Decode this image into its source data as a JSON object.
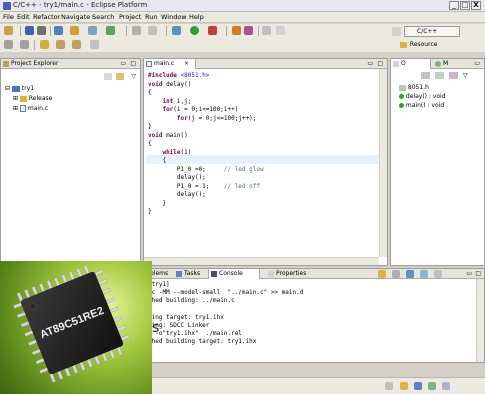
{
  "window": {
    "title": "C/C++ - try1/main.c - Eclipse Platform",
    "min": "_",
    "max": "□",
    "close": "X"
  },
  "menu": [
    "File",
    "Edit",
    "Refactor",
    "Navigate",
    "Search",
    "Project",
    "Run",
    "Window",
    "Help"
  ],
  "perspective": {
    "label": "C/C++",
    "resource": "Resource"
  },
  "project_explorer": {
    "tab": "Project Explorer",
    "tree": [
      {
        "label": "try1",
        "level": 0
      },
      {
        "label": "Release",
        "level": 1
      },
      {
        "label": "main.c",
        "level": 1
      }
    ]
  },
  "editor": {
    "tab": "main.c",
    "code": [
      [
        {
          "c": "pp",
          "t": "#include "
        },
        {
          "c": "str",
          "t": "<8051.h>"
        }
      ],
      [
        {
          "c": "kw",
          "t": "void"
        },
        {
          "c": "",
          "t": " delay()"
        }
      ],
      [
        {
          "c": "",
          "t": "{"
        }
      ],
      [
        {
          "c": "",
          "t": "    "
        },
        {
          "c": "kw",
          "t": "int"
        },
        {
          "c": "",
          "t": " i,j;"
        }
      ],
      [
        {
          "c": "",
          "t": "    "
        },
        {
          "c": "kw",
          "t": "for"
        },
        {
          "c": "",
          "t": "(i = 0;i<=100;i++)"
        }
      ],
      [
        {
          "c": "",
          "t": "        "
        },
        {
          "c": "kw",
          "t": "for"
        },
        {
          "c": "",
          "t": "(j = 0;j<=100;j++);"
        }
      ],
      [
        {
          "c": "",
          "t": "}"
        }
      ],
      [
        {
          "c": "kw",
          "t": "void"
        },
        {
          "c": "",
          "t": " main()"
        }
      ],
      [
        {
          "c": "",
          "t": "{"
        }
      ],
      [
        {
          "c": "",
          "t": "    "
        },
        {
          "c": "kw",
          "t": "while"
        },
        {
          "c": "",
          "t": "(1)"
        }
      ],
      [
        {
          "c": "",
          "t": "    {"
        }
      ],
      [
        {
          "c": "",
          "t": "        P1_0 =0;     "
        },
        {
          "c": "cm",
          "t": "// led glow"
        }
      ],
      [
        {
          "c": "",
          "t": "        delay();"
        }
      ],
      [
        {
          "c": "",
          "t": "        P1_0 = 1;    "
        },
        {
          "c": "cm",
          "t": "// led off"
        }
      ],
      [
        {
          "c": "",
          "t": "        delay();"
        }
      ],
      [
        {
          "c": "",
          "t": "    }"
        }
      ],
      [
        {
          "c": "",
          "t": "}"
        }
      ]
    ]
  },
  "outline": {
    "tabs": [
      "O",
      "M"
    ],
    "items": [
      "8051.h",
      "delay() : void",
      "main() : void"
    ]
  },
  "console": {
    "tabs": [
      "blems",
      "Tasks",
      "Console",
      "Properties"
    ],
    "lines": [
      "[try1]",
      "-c -MM --model-small  \"../main.c\" >> main.d",
      "shed building: ../main.c",
      "",
      "ding target: try1.ihx",
      "king: SDCC Linker",
      "  -o\"try1.ihx\"  ./main.rel",
      "shed building target: try1.ihx"
    ]
  },
  "chip": {
    "marking": "AT89C51RE2"
  },
  "cut_letter": "s"
}
